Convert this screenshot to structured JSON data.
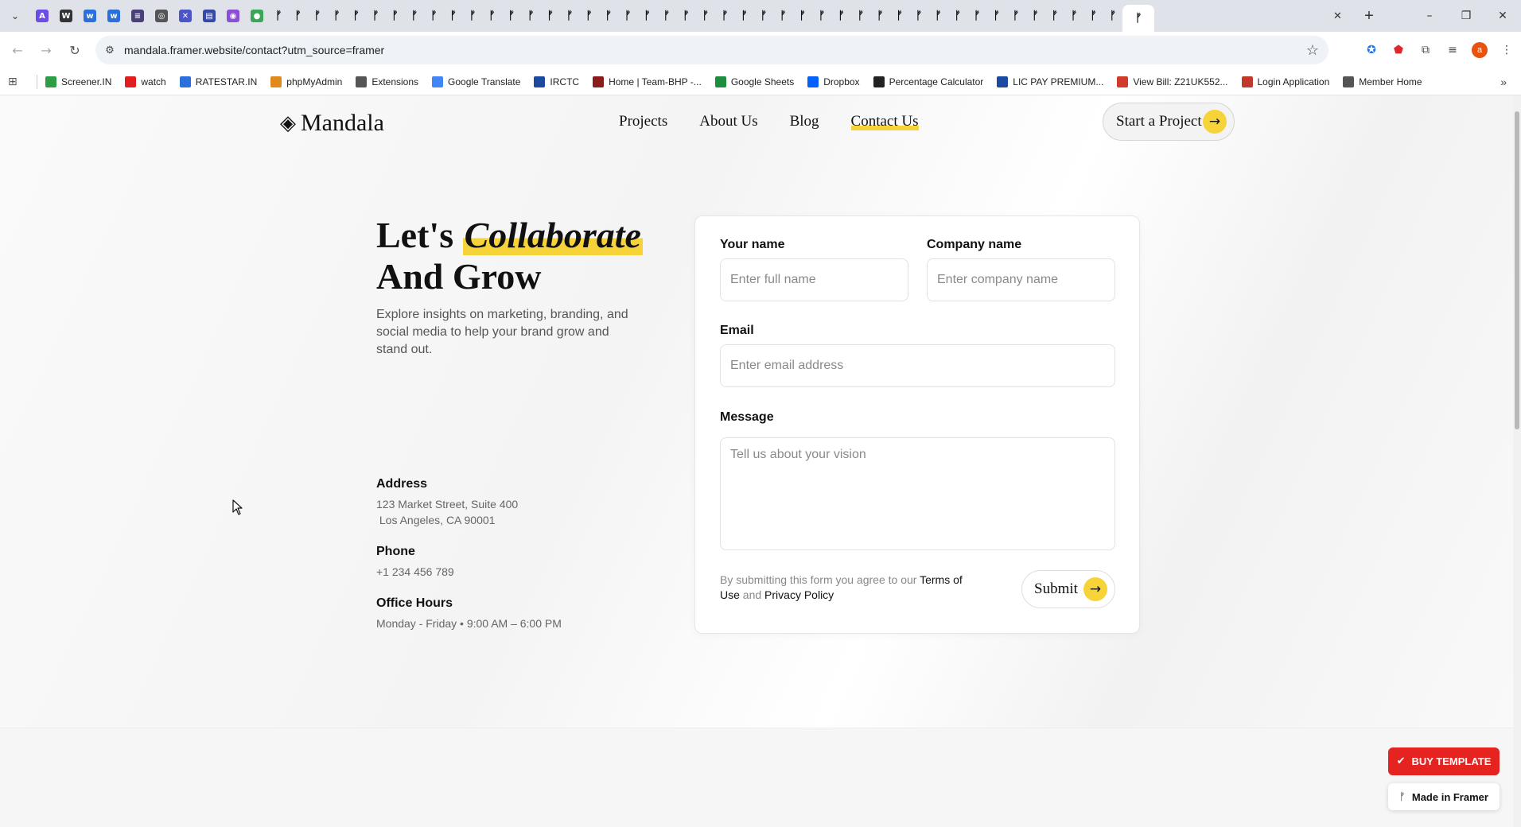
{
  "browser": {
    "url": "mandala.framer.website/contact?utm_source=framer",
    "tab_favicons": [
      {
        "name": "astro",
        "glyph": "A",
        "color": "#6b4ce6"
      },
      {
        "name": "wix",
        "glyph": "W",
        "color": "#333333"
      },
      {
        "name": "w-blue",
        "glyph": "w",
        "color": "#2a6fdb"
      },
      {
        "name": "w-blue2",
        "glyph": "w",
        "color": "#2a6fdb"
      },
      {
        "name": "dark",
        "glyph": "≡",
        "color": "#4a3f7a"
      },
      {
        "name": "stack",
        "glyph": "◎",
        "color": "#555555"
      },
      {
        "name": "puzzle",
        "glyph": "✕",
        "color": "#4c55c8"
      },
      {
        "name": "table",
        "glyph": "▤",
        "color": "#3448a8"
      },
      {
        "name": "circle",
        "glyph": "◉",
        "color": "#8a4fd6"
      },
      {
        "name": "green",
        "glyph": "●",
        "color": "#3aa657"
      }
    ],
    "framer_tab_count": 44,
    "bookmarks": [
      {
        "label": "Screener.IN",
        "color": "#2e9e44"
      },
      {
        "label": "watch",
        "color": "#e01e1e"
      },
      {
        "label": "RATESTAR.IN",
        "color": "#2a6fdb"
      },
      {
        "label": "phpMyAdmin",
        "color": "#e08a1e"
      },
      {
        "label": "Extensions",
        "color": "#555555"
      },
      {
        "label": "Google Translate",
        "color": "#4285f4"
      },
      {
        "label": "IRCTC",
        "color": "#1b4aa0"
      },
      {
        "label": "Home | Team-BHP -...",
        "color": "#8a1c1c"
      },
      {
        "label": "Google Sheets",
        "color": "#1e8e3e"
      },
      {
        "label": "Dropbox",
        "color": "#0061fe"
      },
      {
        "label": "Percentage Calculator",
        "color": "#222222"
      },
      {
        "label": "LIC PAY PREMIUM...",
        "color": "#1b4aa0"
      },
      {
        "label": "View Bill: Z21UK552...",
        "color": "#d13b2a"
      },
      {
        "label": "Login Application",
        "color": "#c0392b"
      },
      {
        "label": "Member Home",
        "color": "#555555"
      }
    ],
    "avatar_initial": "a"
  },
  "site": {
    "logo_text": "Mandala",
    "nav": [
      "Projects",
      "About Us",
      "Blog",
      "Contact Us"
    ],
    "active_nav": "Contact Us",
    "cta_label": "Start a Project",
    "accent_color": "#f7d33a"
  },
  "hero": {
    "title_prefix": "Let's",
    "title_highlight": "Collaborate",
    "title_line2": "And Grow",
    "description": "Explore insights on marketing, branding, and social media to help your brand grow and stand out."
  },
  "contact_info": {
    "address_label": "Address",
    "address_line1": "123 Market Street, Suite 400",
    "address_line2": " Los Angeles, CA 90001",
    "phone_label": "Phone",
    "phone": "+1 234 456 789",
    "hours_label": "Office Hours",
    "hours": "Monday - Friday • 9:00 AM – 6:00 PM"
  },
  "form": {
    "name_label": "Your name",
    "name_placeholder": "Enter full name",
    "company_label": "Company name",
    "company_placeholder": "Enter company name",
    "email_label": "Email",
    "email_placeholder": "Enter email address",
    "message_label": "Message",
    "message_placeholder": "Tell us about your vision",
    "terms_prefix": "By submitting this form you agree to our ",
    "terms_link": "Terms of Use",
    "terms_and": " and ",
    "privacy_link": "Privacy Policy",
    "submit_label": "Submit"
  },
  "badges": {
    "buy_label": "BUY TEMPLATE",
    "buy_color": "#e52421",
    "made_label": "Made in Framer"
  }
}
